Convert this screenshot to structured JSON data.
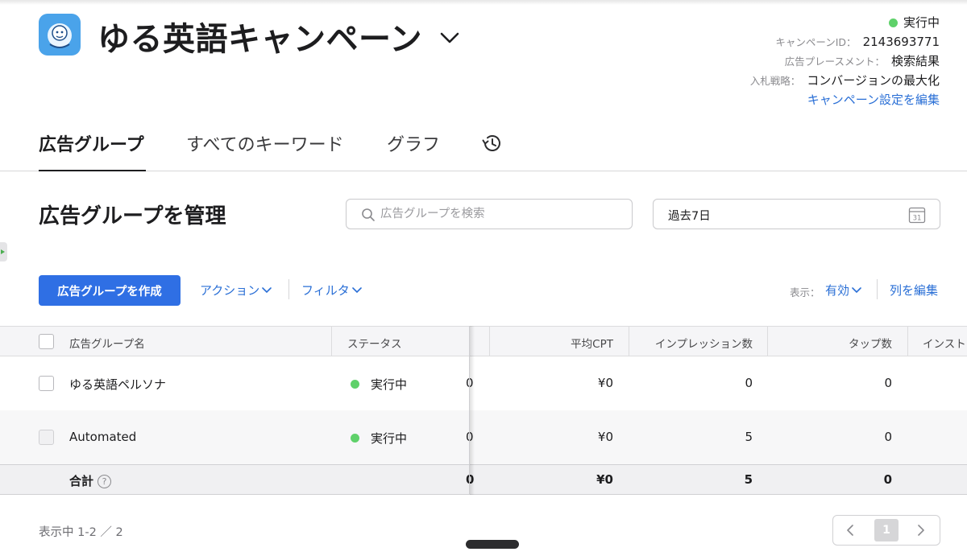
{
  "header": {
    "campaign_title": "ゆる英語キャンペーン",
    "status": "実行中",
    "campaign_id_label": "キャンペーンID：",
    "campaign_id": "2143693771",
    "placement_label": "広告プレースメント：",
    "placement": "検索結果",
    "bid_label": "入札戦略：",
    "bid": "コンバージョンの最大化",
    "edit_settings": "キャンペーン設定を編集"
  },
  "tabs": [
    {
      "label": "広告グループ",
      "active": true
    },
    {
      "label": "すべてのキーワード"
    },
    {
      "label": "グラフ"
    }
  ],
  "section": {
    "title": "広告グループを管理",
    "search_placeholder": "広告グループを検索",
    "date_range": "過去7日",
    "calendar_day": "31"
  },
  "toolbar": {
    "create_button": "広告グループを作成",
    "actions": "アクション",
    "filter": "フィルタ",
    "show_label": "表示：",
    "show_value": "有効",
    "edit_columns": "列を編集"
  },
  "table": {
    "columns": [
      "広告グループ名",
      "ステータス",
      "平均CPT",
      "インプレッション数",
      "タップ数",
      "インストー"
    ],
    "rows": [
      {
        "name": "ゆる英語ペルソナ",
        "status": "実行中",
        "partial": "0",
        "avg_cpt": "¥0",
        "impressions": "0",
        "taps": "0"
      },
      {
        "name": "Automated",
        "status": "実行中",
        "partial": "0",
        "avg_cpt": "¥0",
        "impressions": "5",
        "taps": "0"
      }
    ],
    "total": {
      "label": "合計",
      "help": "?",
      "partial": "0",
      "avg_cpt": "¥0",
      "impressions": "5",
      "taps": "0"
    }
  },
  "footer": {
    "showing": "表示中 1-2 ／ 2",
    "current_page": "1"
  },
  "colors": {
    "accent": "#2f6fe4",
    "link": "#2a6fd6",
    "status_running": "#5fd16a"
  }
}
